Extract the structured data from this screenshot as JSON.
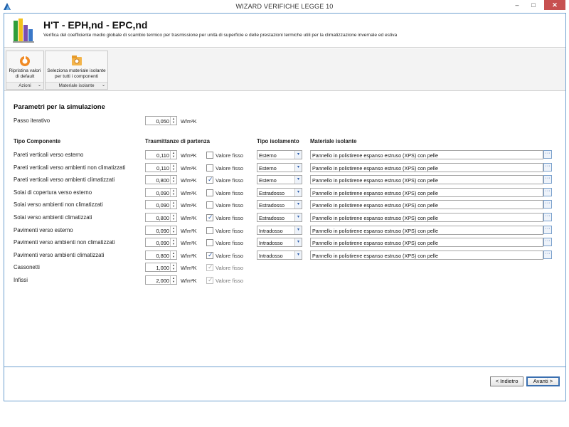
{
  "window": {
    "title": "WIZARD VERIFICHE LEGGE 10",
    "min_label": "–",
    "max_label": "□",
    "close_label": "✕"
  },
  "header": {
    "title": "H'T - EPH,nd - EPC,nd",
    "subtitle": "Verifica del coefficiente medio globale di scambio termico per trasmissione per unità di superficie e delle prestazioni termiche utili per la climatizzazione invernale ed estiva"
  },
  "ribbon": {
    "groups": [
      {
        "button_label_1": "Ripristina valori",
        "button_label_2": "di default",
        "group_label": "Azioni"
      },
      {
        "button_label_1": "Seleziona materiale isolante",
        "button_label_2": "per tutti i componenti",
        "group_label": "Materiale isolante"
      }
    ]
  },
  "content": {
    "section_title": "Parametri per la simulazione",
    "passo": {
      "label": "Passo iterativo",
      "value": "0,050",
      "unit": "W/m²K"
    },
    "headers": {
      "componente": "Tipo Componente",
      "trasmittanze": "Trasmittanze di partenza",
      "isolamento": "Tipo isolamento",
      "materiale": "Materiale isolante"
    },
    "fixed_label": "Valore fisso",
    "unit": "W/m²K",
    "rows": [
      {
        "label": "Pareti verticali verso esterno",
        "value": "0,110",
        "fixed": false,
        "disabled": false,
        "isolamento": "Esterno",
        "materiale": "Pannello in polistirene espanso estruso (XPS) con pelle"
      },
      {
        "label": "Pareti verticali verso ambienti non climatizzati",
        "value": "0,110",
        "fixed": false,
        "disabled": false,
        "isolamento": "Esterno",
        "materiale": "Pannello in polistirene espanso estruso (XPS) con pelle"
      },
      {
        "label": "Pareti verticali verso ambienti climatizzati",
        "value": "0,800",
        "fixed": true,
        "disabled": false,
        "isolamento": "Esterno",
        "materiale": "Pannello in polistirene espanso estruso (XPS) con pelle"
      },
      {
        "label": "Solai di copertura verso esterno",
        "value": "0,090",
        "fixed": false,
        "disabled": false,
        "isolamento": "Estradosso",
        "materiale": "Pannello in polistirene espanso estruso (XPS) con pelle"
      },
      {
        "label": "Solai verso ambienti non climatizzati",
        "value": "0,090",
        "fixed": false,
        "disabled": false,
        "isolamento": "Estradosso",
        "materiale": "Pannello in polistirene espanso estruso (XPS) con pelle"
      },
      {
        "label": "Solai verso ambienti climatizzati",
        "value": "0,800",
        "fixed": true,
        "disabled": false,
        "isolamento": "Estradosso",
        "materiale": "Pannello in polistirene espanso estruso (XPS) con pelle"
      },
      {
        "label": "Pavimenti verso esterno",
        "value": "0,090",
        "fixed": false,
        "disabled": false,
        "isolamento": "Intradosso",
        "materiale": "Pannello in polistirene espanso estruso (XPS) con pelle"
      },
      {
        "label": "Pavimenti verso ambienti non climatizzati",
        "value": "0,090",
        "fixed": false,
        "disabled": false,
        "isolamento": "Intradosso",
        "materiale": "Pannello in polistirene espanso estruso (XPS) con pelle"
      },
      {
        "label": "Pavimenti verso ambienti climatizzati",
        "value": "0,800",
        "fixed": true,
        "disabled": false,
        "isolamento": "Intradosso",
        "materiale": "Pannello in polistirene espanso estruso (XPS) con pelle"
      },
      {
        "label": "Cassonetti",
        "value": "1,000",
        "fixed": true,
        "disabled": true
      },
      {
        "label": "Infissi",
        "value": "2,000",
        "fixed": true,
        "disabled": true
      }
    ]
  },
  "footer": {
    "back_label": "< Indietro",
    "next_label": "Avanti >"
  },
  "colors": {
    "accent": "#2a5aa8",
    "frame": "#6fa0d0",
    "close": "#c75050"
  }
}
